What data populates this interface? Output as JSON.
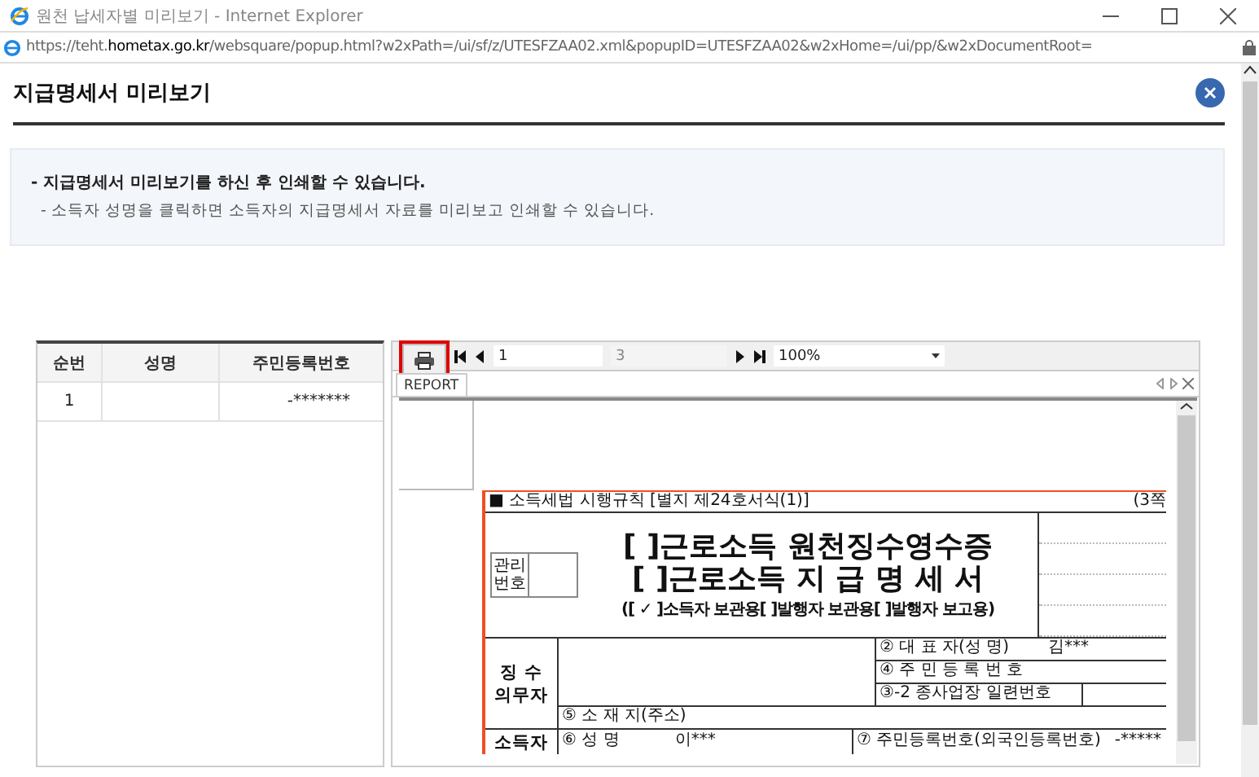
{
  "window": {
    "title": "원천 납세자별 미리보기 - Internet Explorer"
  },
  "address_bar": {
    "url": "https://teht.**hometax.go.kr**/websquare/popup.html?w2xPath=/ui/sf/z/UTESFZAA02.xml&popupID=UTESFZAA02&w2xHome=/ui/pp/&w2xDocumentRoot="
  },
  "popup": {
    "title": "지급명세서 미리보기"
  },
  "notice": {
    "heading": "- 지급명세서 미리보기를 하신 후 인쇄할 수 있습니다.",
    "detail": "- 소득자 성명을 클릭하면 소득자의 지급명세서 자료를 미리보고 인쇄할 수 있습니다."
  },
  "grid": {
    "columns": [
      "순번",
      "성명",
      "주민등록번호"
    ],
    "rows": [
      {
        "seq": "1",
        "resident_no": "-*******"
      }
    ]
  },
  "viewer": {
    "print_highlighted": true,
    "page": "1",
    "page_count": "3",
    "zoom": "100%",
    "tabs": [
      {
        "label": "REPORT",
        "selected": true
      }
    ]
  },
  "document": {
    "form_ref": "■ 소득세법 시행규칙 [별지 제24호서식(1)]",
    "page_ref": "(3쪽",
    "management_label": "관리 번호",
    "titles": [
      "[ ]근로소득 원천징수영수증",
      "[ ]근로소득 지 급 명 세 서"
    ],
    "copy_types": "([ ✓ ]소득자 보관용[    ]발행자 보관용[    ]발행자 보고용)",
    "withholder": {
      "label": "징 수 의무자",
      "fields": [
        {
          "kind": "text",
          "label": "② 대 표 자(성 명)",
          "value": "김***"
        },
        {
          "kind": "text",
          "label": "④ 주 민 등 록 번 호"
        },
        {
          "kind": "split",
          "label": "③-2 종사업장 일련번호"
        }
      ],
      "address_label": "⑤ 소 재 지(주소)"
    },
    "earner": {
      "label": "소득자",
      "name_label": "⑥ 성 명",
      "name_value": "이***",
      "id_label": "⑦ 주민등록번호(외국인등록번호)",
      "id_value": "-*****"
    }
  }
}
